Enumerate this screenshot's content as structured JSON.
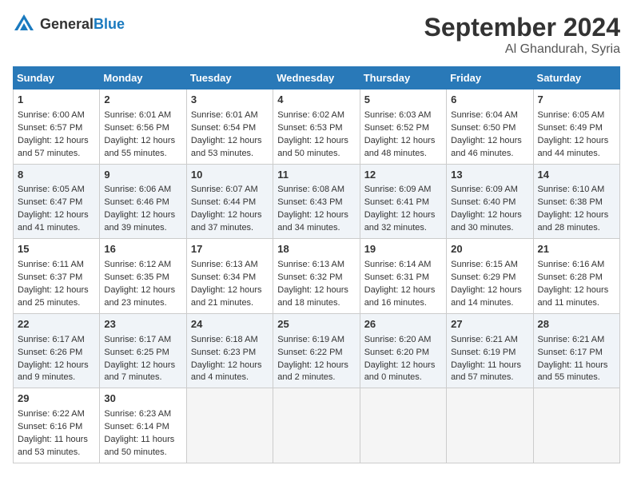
{
  "logo": {
    "general": "General",
    "blue": "Blue"
  },
  "title": "September 2024",
  "subtitle": "Al Ghandurah, Syria",
  "days_of_week": [
    "Sunday",
    "Monday",
    "Tuesday",
    "Wednesday",
    "Thursday",
    "Friday",
    "Saturday"
  ],
  "weeks": [
    [
      {
        "day": "1",
        "sunrise": "Sunrise: 6:00 AM",
        "sunset": "Sunset: 6:57 PM",
        "daylight": "Daylight: 12 hours and 57 minutes."
      },
      {
        "day": "2",
        "sunrise": "Sunrise: 6:01 AM",
        "sunset": "Sunset: 6:56 PM",
        "daylight": "Daylight: 12 hours and 55 minutes."
      },
      {
        "day": "3",
        "sunrise": "Sunrise: 6:01 AM",
        "sunset": "Sunset: 6:54 PM",
        "daylight": "Daylight: 12 hours and 53 minutes."
      },
      {
        "day": "4",
        "sunrise": "Sunrise: 6:02 AM",
        "sunset": "Sunset: 6:53 PM",
        "daylight": "Daylight: 12 hours and 50 minutes."
      },
      {
        "day": "5",
        "sunrise": "Sunrise: 6:03 AM",
        "sunset": "Sunset: 6:52 PM",
        "daylight": "Daylight: 12 hours and 48 minutes."
      },
      {
        "day": "6",
        "sunrise": "Sunrise: 6:04 AM",
        "sunset": "Sunset: 6:50 PM",
        "daylight": "Daylight: 12 hours and 46 minutes."
      },
      {
        "day": "7",
        "sunrise": "Sunrise: 6:05 AM",
        "sunset": "Sunset: 6:49 PM",
        "daylight": "Daylight: 12 hours and 44 minutes."
      }
    ],
    [
      {
        "day": "8",
        "sunrise": "Sunrise: 6:05 AM",
        "sunset": "Sunset: 6:47 PM",
        "daylight": "Daylight: 12 hours and 41 minutes."
      },
      {
        "day": "9",
        "sunrise": "Sunrise: 6:06 AM",
        "sunset": "Sunset: 6:46 PM",
        "daylight": "Daylight: 12 hours and 39 minutes."
      },
      {
        "day": "10",
        "sunrise": "Sunrise: 6:07 AM",
        "sunset": "Sunset: 6:44 PM",
        "daylight": "Daylight: 12 hours and 37 minutes."
      },
      {
        "day": "11",
        "sunrise": "Sunrise: 6:08 AM",
        "sunset": "Sunset: 6:43 PM",
        "daylight": "Daylight: 12 hours and 34 minutes."
      },
      {
        "day": "12",
        "sunrise": "Sunrise: 6:09 AM",
        "sunset": "Sunset: 6:41 PM",
        "daylight": "Daylight: 12 hours and 32 minutes."
      },
      {
        "day": "13",
        "sunrise": "Sunrise: 6:09 AM",
        "sunset": "Sunset: 6:40 PM",
        "daylight": "Daylight: 12 hours and 30 minutes."
      },
      {
        "day": "14",
        "sunrise": "Sunrise: 6:10 AM",
        "sunset": "Sunset: 6:38 PM",
        "daylight": "Daylight: 12 hours and 28 minutes."
      }
    ],
    [
      {
        "day": "15",
        "sunrise": "Sunrise: 6:11 AM",
        "sunset": "Sunset: 6:37 PM",
        "daylight": "Daylight: 12 hours and 25 minutes."
      },
      {
        "day": "16",
        "sunrise": "Sunrise: 6:12 AM",
        "sunset": "Sunset: 6:35 PM",
        "daylight": "Daylight: 12 hours and 23 minutes."
      },
      {
        "day": "17",
        "sunrise": "Sunrise: 6:13 AM",
        "sunset": "Sunset: 6:34 PM",
        "daylight": "Daylight: 12 hours and 21 minutes."
      },
      {
        "day": "18",
        "sunrise": "Sunrise: 6:13 AM",
        "sunset": "Sunset: 6:32 PM",
        "daylight": "Daylight: 12 hours and 18 minutes."
      },
      {
        "day": "19",
        "sunrise": "Sunrise: 6:14 AM",
        "sunset": "Sunset: 6:31 PM",
        "daylight": "Daylight: 12 hours and 16 minutes."
      },
      {
        "day": "20",
        "sunrise": "Sunrise: 6:15 AM",
        "sunset": "Sunset: 6:29 PM",
        "daylight": "Daylight: 12 hours and 14 minutes."
      },
      {
        "day": "21",
        "sunrise": "Sunrise: 6:16 AM",
        "sunset": "Sunset: 6:28 PM",
        "daylight": "Daylight: 12 hours and 11 minutes."
      }
    ],
    [
      {
        "day": "22",
        "sunrise": "Sunrise: 6:17 AM",
        "sunset": "Sunset: 6:26 PM",
        "daylight": "Daylight: 12 hours and 9 minutes."
      },
      {
        "day": "23",
        "sunrise": "Sunrise: 6:17 AM",
        "sunset": "Sunset: 6:25 PM",
        "daylight": "Daylight: 12 hours and 7 minutes."
      },
      {
        "day": "24",
        "sunrise": "Sunrise: 6:18 AM",
        "sunset": "Sunset: 6:23 PM",
        "daylight": "Daylight: 12 hours and 4 minutes."
      },
      {
        "day": "25",
        "sunrise": "Sunrise: 6:19 AM",
        "sunset": "Sunset: 6:22 PM",
        "daylight": "Daylight: 12 hours and 2 minutes."
      },
      {
        "day": "26",
        "sunrise": "Sunrise: 6:20 AM",
        "sunset": "Sunset: 6:20 PM",
        "daylight": "Daylight: 12 hours and 0 minutes."
      },
      {
        "day": "27",
        "sunrise": "Sunrise: 6:21 AM",
        "sunset": "Sunset: 6:19 PM",
        "daylight": "Daylight: 11 hours and 57 minutes."
      },
      {
        "day": "28",
        "sunrise": "Sunrise: 6:21 AM",
        "sunset": "Sunset: 6:17 PM",
        "daylight": "Daylight: 11 hours and 55 minutes."
      }
    ],
    [
      {
        "day": "29",
        "sunrise": "Sunrise: 6:22 AM",
        "sunset": "Sunset: 6:16 PM",
        "daylight": "Daylight: 11 hours and 53 minutes."
      },
      {
        "day": "30",
        "sunrise": "Sunrise: 6:23 AM",
        "sunset": "Sunset: 6:14 PM",
        "daylight": "Daylight: 11 hours and 50 minutes."
      },
      null,
      null,
      null,
      null,
      null
    ]
  ]
}
